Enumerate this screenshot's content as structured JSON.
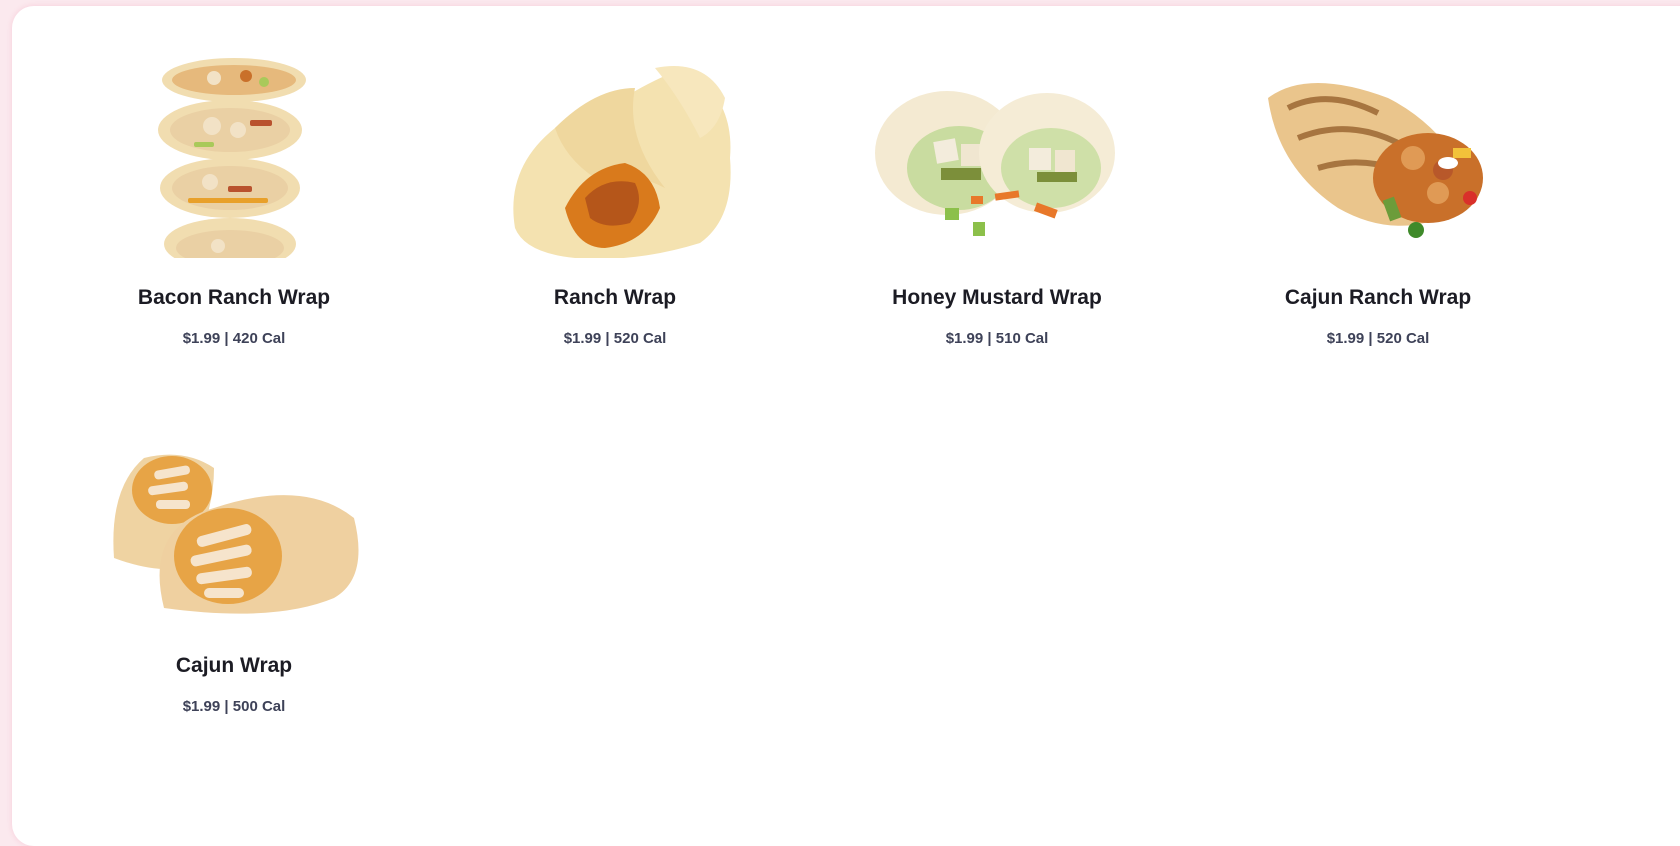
{
  "colors": {
    "page_background": "#fbe9ee",
    "card_background": "#ffffff",
    "title_text": "#1c1c24",
    "meta_text": "#3e4258",
    "tortilla": "#f1ddb0",
    "tortilla_char": "#b4743a",
    "filling_chicken": "#e8c79a",
    "filling_sauce": "#d97a1c",
    "lettuce": "#a9c95a"
  },
  "menu": {
    "items": [
      {
        "name": "Bacon Ranch Wrap",
        "meta": "$1.99 | 420 Cal",
        "image": "stacked-wrap-halves-photo"
      },
      {
        "name": "Ranch Wrap",
        "meta": "$1.99 | 520 Cal",
        "image": "folded-wrap-photo"
      },
      {
        "name": "Honey Mustard Wrap",
        "meta": "$1.99 | 510 Cal",
        "image": "cut-wrap-pair-photo"
      },
      {
        "name": "Cajun Ranch Wrap",
        "meta": "$1.99 | 520 Cal",
        "image": "grilled-wrap-photo"
      },
      {
        "name": "Cajun Wrap",
        "meta": "$1.99 | 500 Cal",
        "image": "cut-wrap-pair-chicken-photo"
      }
    ]
  }
}
